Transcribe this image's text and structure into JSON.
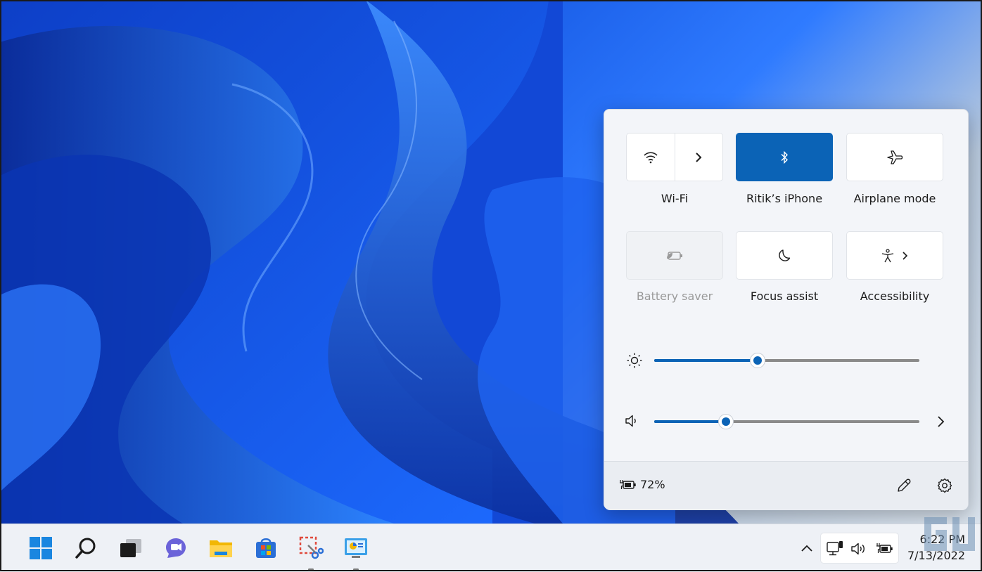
{
  "quick_settings": {
    "tiles": [
      {
        "label": "Wi-Fi",
        "icon": "wifi-icon",
        "state": "on",
        "expandable": true
      },
      {
        "label": "Ritik’s iPhone",
        "icon": "bluetooth-icon",
        "state": "active"
      },
      {
        "label": "Airplane mode",
        "icon": "airplane-icon",
        "state": "off"
      },
      {
        "label": "Battery saver",
        "icon": "battery-saver-icon",
        "state": "disabled"
      },
      {
        "label": "Focus assist",
        "icon": "moon-icon",
        "state": "off"
      },
      {
        "label": "Accessibility",
        "icon": "accessibility-icon",
        "state": "off",
        "expandable": true
      }
    ],
    "brightness": {
      "icon": "brightness-icon",
      "level": 0.39
    },
    "volume": {
      "icon": "speaker-icon",
      "level": 0.27
    },
    "battery": {
      "icon": "battery-charging-icon",
      "percent_text": "72%"
    },
    "footer_icons": [
      "edit-icon",
      "settings-icon"
    ]
  },
  "taskbar": {
    "apps": [
      "start-icon",
      "search-icon",
      "task-view-icon",
      "teams-chat-icon",
      "file-explorer-icon",
      "store-icon",
      "snipping-tool-icon",
      "control-panel-icon"
    ],
    "tray_icons": [
      "chevron-up-icon",
      "network-icon",
      "speaker-icon",
      "battery-charging-icon"
    ],
    "time": "6:22 PM",
    "date": "7/13/2022"
  },
  "colors": {
    "accent": "#0b63b6",
    "panel": "#f3f5f9",
    "taskbar": "#eef1f6"
  }
}
